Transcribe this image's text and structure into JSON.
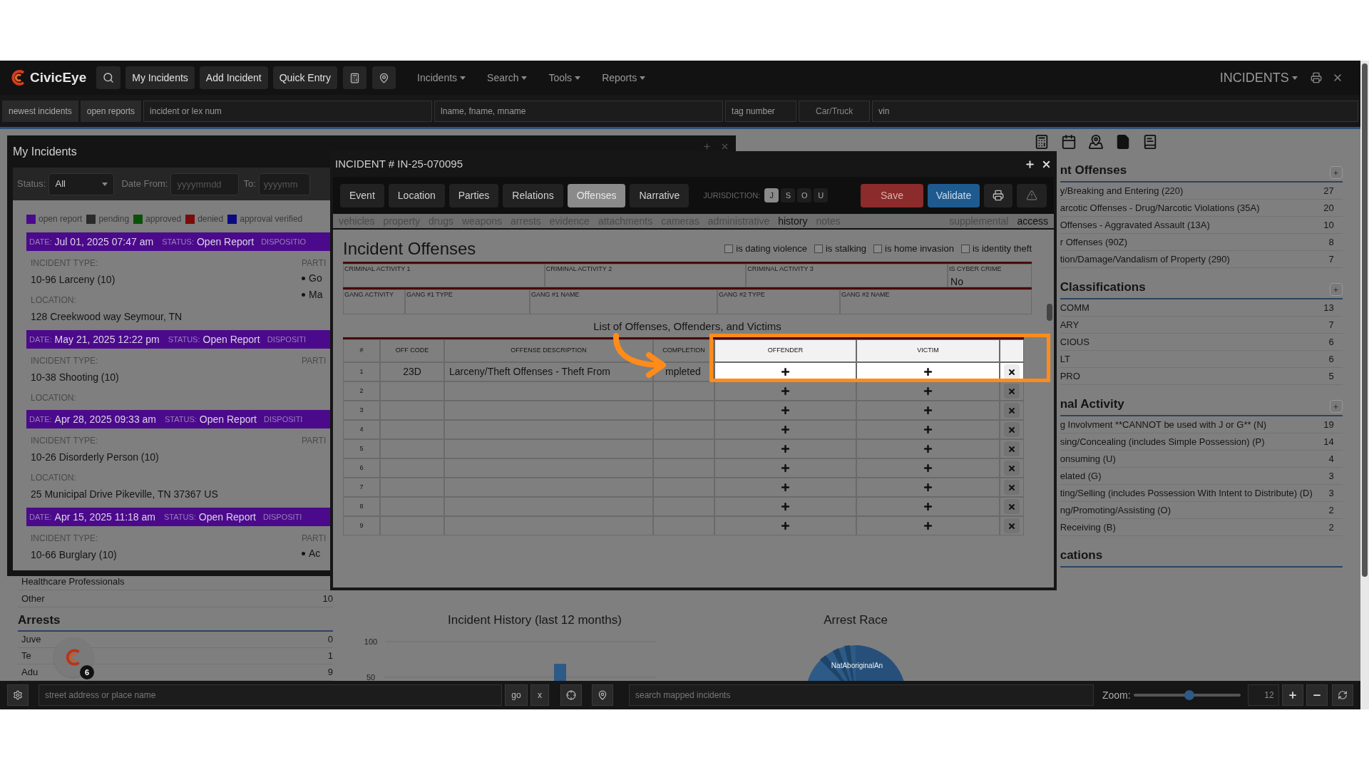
{
  "nav": {
    "brand": "CivicEye",
    "buttons": [
      "My Incidents",
      "Add Incident",
      "Quick Entry"
    ],
    "menus": [
      "Incidents",
      "Search",
      "Tools",
      "Reports"
    ],
    "module": "INCIDENTS"
  },
  "quick_search": {
    "buttons": [
      "newest incidents",
      "open reports"
    ],
    "fields": [
      {
        "kind": "input",
        "placeholder": "incident or lex num"
      },
      {
        "kind": "input",
        "placeholder": "lname, fname, mname"
      },
      {
        "kind": "input",
        "placeholder": "tag number"
      },
      {
        "kind": "select",
        "value": "Car/Truck"
      },
      {
        "kind": "input",
        "placeholder": "vin"
      }
    ]
  },
  "my_incidents": {
    "title": "My Incidents",
    "status_label": "Status:",
    "status_value": "All",
    "date_from_label": "Date From:",
    "date_from_placeholder": "yyyymmdd",
    "to_label": "To:",
    "to_placeholder": "yyyymm",
    "legend": [
      {
        "label": "open report",
        "color": "#4b0a8c"
      },
      {
        "label": "pending",
        "color": "#2a2a2a"
      },
      {
        "label": "approved",
        "color": "#0a500a"
      },
      {
        "label": "denied",
        "color": "#7a0b0b"
      },
      {
        "label": "approval verified",
        "color": "#0b0b80"
      }
    ],
    "incidents": [
      {
        "color": "#4b0a8c",
        "date_label": "DATE:",
        "date": "Jul 01, 2025 07:47 am",
        "status_label": "STATUS:",
        "status": "Open Report",
        "disposition_label": "DISPOSITIO",
        "type_label": "INCIDENT TYPE:",
        "type": "10-96 Larceny (10)",
        "parties_label": "PARTI",
        "parties": [
          "Go",
          "Ma"
        ],
        "location_label": "LOCATION:",
        "location": "128 Creekwood way Seymour, TN"
      },
      {
        "color": "#4b0a8c",
        "date_label": "DATE:",
        "date": "May 21, 2025 12:22 pm",
        "status_label": "STATUS:",
        "status": "Open Report",
        "disposition_label": "DISPOSITI",
        "type_label": "INCIDENT TYPE:",
        "type": "10-38 Shooting (10)",
        "parties_label": "PARTI",
        "location_label": "LOCATION:"
      },
      {
        "color": "#4b0a8c",
        "date_label": "DATE:",
        "date": "Apr 28, 2025 09:33 am",
        "status_label": "STATUS:",
        "status": "Open Report",
        "disposition_label": "DISPOSITI",
        "type_label": "INCIDENT TYPE:",
        "type": "10-26 Disorderly Person (10)",
        "parties_label": "PARTI",
        "location_label": "LOCATION:",
        "location": "25 Municipal Drive Pikeville, TN 37367 US"
      },
      {
        "color": "#4b0a8c",
        "date_label": "DATE:",
        "date": "Apr 15, 2025 11:18 am",
        "status_label": "STATUS:",
        "status": "Open Report",
        "disposition_label": "DISPOSITI",
        "type_label": "INCIDENT TYPE:",
        "type": "10-66 Burglary (10)",
        "parties_label": "PARTI",
        "parties": [
          "Ac"
        ]
      }
    ]
  },
  "incident": {
    "title": "INCIDENT # IN-25-070095",
    "tabs": [
      {
        "label": "Event",
        "selected": false
      },
      {
        "label": "Location",
        "selected": false
      },
      {
        "label": "Parties",
        "selected": false
      },
      {
        "label": "Relations",
        "selected": false
      },
      {
        "label": "Offenses",
        "selected": true
      },
      {
        "label": "Narrative",
        "selected": false
      }
    ],
    "jurisdiction_label": "JURISDICTION:",
    "jurisdiction": [
      {
        "label": "J",
        "selected": true
      },
      {
        "label": "S",
        "selected": false
      },
      {
        "label": "O",
        "selected": false
      },
      {
        "label": "U",
        "selected": false
      }
    ],
    "save": "Save",
    "validate": "Validate",
    "subtabs": [
      {
        "label": "vehicles",
        "active": false
      },
      {
        "label": "property",
        "active": false
      },
      {
        "label": "drugs",
        "active": false
      },
      {
        "label": "weapons",
        "active": false
      },
      {
        "label": "arrests",
        "active": false
      },
      {
        "label": "evidence",
        "active": false
      },
      {
        "label": "attachments",
        "active": false
      },
      {
        "label": "cameras",
        "active": false
      },
      {
        "label": "administrative",
        "active": false
      },
      {
        "label": "history",
        "active": true
      },
      {
        "label": "notes",
        "active": false
      }
    ],
    "subtabs_right": [
      {
        "label": "supplemental",
        "active": false
      },
      {
        "label": "access",
        "active": true
      }
    ],
    "heading": "Incident Offenses",
    "flags": [
      {
        "label": "is dating violence",
        "checked": false
      },
      {
        "label": "is stalking",
        "checked": false
      },
      {
        "label": "is home invasion",
        "checked": false
      },
      {
        "label": "is identity theft",
        "checked": false
      }
    ],
    "criminal_fields": [
      {
        "label": "CRIMINAL ACTIVITY 1"
      },
      {
        "label": "CRIMINAL ACTIVITY 2"
      },
      {
        "label": "CRIMINAL ACTIVITY 3"
      },
      {
        "label": "IS CYBER CRIME",
        "value": "No"
      }
    ],
    "gang_fields": [
      {
        "label": "GANG ACTIVITY"
      },
      {
        "label": "GANG #1 TYPE"
      },
      {
        "label": "GANG #1 NAME"
      },
      {
        "label": "GANG #2 TYPE"
      },
      {
        "label": "GANG #2 NAME"
      }
    ],
    "table_title": "List of Offenses, Offenders, and Victims",
    "columns": [
      {
        "label": "#",
        "highlighted": false
      },
      {
        "label": "OFF CODE",
        "highlighted": false
      },
      {
        "label": "OFFENSE DESCRIPTION",
        "highlighted": false
      },
      {
        "label": "COMPLETION",
        "highlighted": false
      },
      {
        "label": "OFFENDER",
        "highlighted": true
      },
      {
        "label": "VICTIM",
        "highlighted": true
      }
    ],
    "rows": [
      {
        "number": "1",
        "off_code": "23D",
        "description": "Larceny/Theft Offenses - Theft From",
        "completion": "mpleted",
        "highlighted": true
      },
      {
        "number": "2",
        "highlighted": false
      },
      {
        "number": "3",
        "highlighted": false
      },
      {
        "number": "4",
        "highlighted": false
      },
      {
        "number": "5",
        "highlighted": false
      },
      {
        "number": "6",
        "highlighted": false
      },
      {
        "number": "7",
        "highlighted": false
      },
      {
        "number": "8",
        "highlighted": false
      },
      {
        "number": "9",
        "highlighted": false
      }
    ]
  },
  "dashboard": {
    "left_rows": [
      {
        "label": "Healthcare Professionals"
      },
      {
        "label": "Other",
        "count": "10"
      }
    ],
    "arrests": {
      "title": "Arrests",
      "rows": [
        {
          "label": "Juve",
          "count": "0"
        },
        {
          "label": "Te",
          "count": "1"
        },
        {
          "label": "Adu",
          "count": "9"
        }
      ]
    },
    "history_chart": {
      "chart_data": {
        "type": "bar",
        "title": "Incident History (last 12 months)",
        "ylim": [
          0,
          100
        ],
        "yticks": [
          50,
          100
        ],
        "values": [
          69
        ]
      }
    },
    "arrest_race": {
      "title": "Arrest Race",
      "slice_label": "NatAboriginalAn"
    },
    "sections": [
      {
        "title": "nt Offenses",
        "rows": [
          {
            "label": "y/Breaking and Entering (220)",
            "count": "27"
          },
          {
            "label": "arcotic Offenses - Drug/Narcotic Violations (35A)",
            "count": "20"
          },
          {
            "label": "Offenses - Aggravated Assault (13A)",
            "count": "10"
          },
          {
            "label": "r Offenses (90Z)",
            "count": "8"
          },
          {
            "label": "tion/Damage/Vandalism of Property (290)",
            "count": "7"
          }
        ]
      },
      {
        "title": "Classifications",
        "rows": [
          {
            "label": "COMM",
            "count": "13"
          },
          {
            "label": "ARY",
            "count": "7"
          },
          {
            "label": "CIOUS",
            "count": "6"
          },
          {
            "label": "LT",
            "count": "6"
          },
          {
            "label": "PRO",
            "count": "5"
          }
        ]
      },
      {
        "title": "nal Activity",
        "rows": [
          {
            "label": "g Involvment **CANNOT be used with J or G** (N)",
            "count": "19"
          },
          {
            "label": "sing/Concealing (includes Simple Possession) (P)",
            "count": "14"
          },
          {
            "label": "onsuming (U)",
            "count": "4"
          },
          {
            "label": "elated (G)",
            "count": "3"
          },
          {
            "label": "ting/Selling (includes Possession With Intent to Distribute) (D)",
            "count": "3"
          },
          {
            "label": "ng/Promoting/Assisting (O)",
            "count": "2"
          },
          {
            "label": "Receiving (B)",
            "count": "2"
          }
        ]
      },
      {
        "title": "cations"
      }
    ]
  },
  "notification_count": "6",
  "bottom_bar": {
    "address_placeholder": "street address or place name",
    "go": "go",
    "clear": "x",
    "map_search_placeholder": "search mapped incidents",
    "zoom_label": "Zoom:",
    "zoom": {
      "level": 0.52
    },
    "zoom_value": "12"
  }
}
